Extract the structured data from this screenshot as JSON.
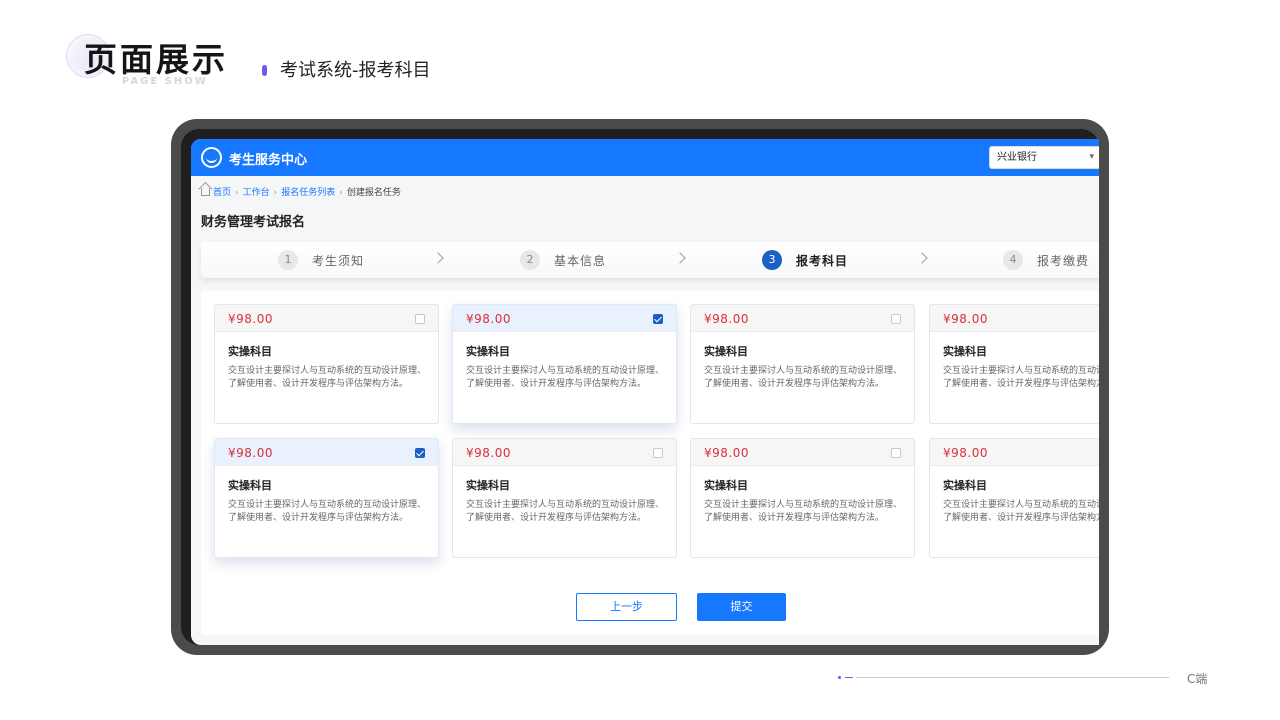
{
  "slide": {
    "title": "页面展示",
    "subtitle_en": "PAGE SHOW",
    "subtitle": "考试系统-报考科目",
    "footer_label": "C端"
  },
  "app": {
    "name": "考生服务中心",
    "bank_select": {
      "value": "兴业银行"
    }
  },
  "breadcrumb": [
    "首页",
    "工作台",
    "报名任务列表",
    "创建报名任务"
  ],
  "page_title": "财务管理考试报名",
  "steps": [
    {
      "num": "1",
      "label": "考生须知",
      "active": false
    },
    {
      "num": "2",
      "label": "基本信息",
      "active": false
    },
    {
      "num": "3",
      "label": "报考科目",
      "active": true
    },
    {
      "num": "4",
      "label": "报考缴费",
      "active": false
    }
  ],
  "cards": [
    {
      "price": "¥98.00",
      "title": "实操科目",
      "desc": "交互设计主要探讨人与互动系统的互动设计原理、了解使用者、设计开发程序与评估架构方法。",
      "checked": false
    },
    {
      "price": "¥98.00",
      "title": "实操科目",
      "desc": "交互设计主要探讨人与互动系统的互动设计原理、了解使用者、设计开发程序与评估架构方法。",
      "checked": true
    },
    {
      "price": "¥98.00",
      "title": "实操科目",
      "desc": "交互设计主要探讨人与互动系统的互动设计原理、了解使用者、设计开发程序与评估架构方法。",
      "checked": false
    },
    {
      "price": "¥98.00",
      "title": "实操科目",
      "desc": "交互设计主要探讨人与互动系统的互动设计原理、了解使用者、设计开发程序与评估架构方法。",
      "checked": false
    },
    {
      "price": "¥98.00",
      "title": "实操科目",
      "desc": "交互设计主要探讨人与互动系统的互动设计原理、了解使用者、设计开发程序与评估架构方法。",
      "checked": true
    },
    {
      "price": "¥98.00",
      "title": "实操科目",
      "desc": "交互设计主要探讨人与互动系统的互动设计原理、了解使用者、设计开发程序与评估架构方法。",
      "checked": false
    },
    {
      "price": "¥98.00",
      "title": "实操科目",
      "desc": "交互设计主要探讨人与互动系统的互动设计原理、了解使用者、设计开发程序与评估架构方法。",
      "checked": false
    },
    {
      "price": "¥98.00",
      "title": "实操科目",
      "desc": "交互设计主要探讨人与互动系统的互动设计原理、了解使用者、设计开发程序与评估架构方法。",
      "checked": false
    }
  ],
  "buttons": {
    "prev": "上一步",
    "submit": "提交"
  },
  "colors": {
    "primary": "#1677ff",
    "step_active": "#1c5fc5",
    "price": "#d9303a",
    "accent": "#6a5df0"
  }
}
